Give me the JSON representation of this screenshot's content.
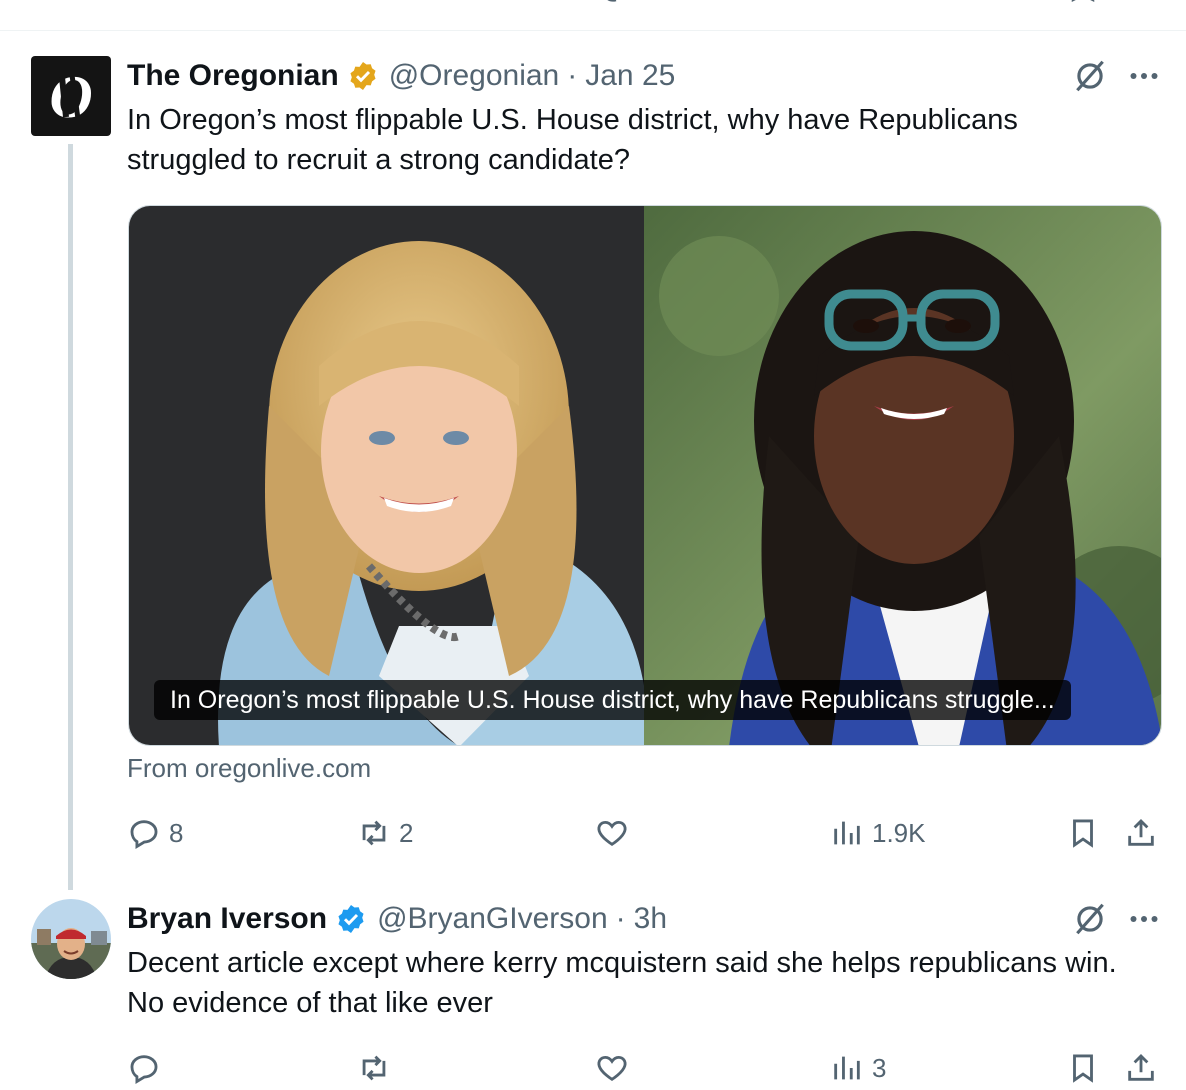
{
  "tweets": [
    {
      "display_name": "The Oregonian",
      "verified": "gold",
      "handle": "@Oregonian",
      "separator": "·",
      "time": "Jan 25",
      "text": "In Oregon’s most flippable U.S. House district, why have Republicans struggled to recruit a strong candidate?",
      "card": {
        "caption": "In Oregon’s most flippable U.S. House district, why have Republicans struggle...",
        "source": "From oregonlive.com"
      },
      "stats": {
        "replies": "8",
        "reposts": "2",
        "likes": "",
        "views": "1.9K"
      }
    },
    {
      "display_name": "Bryan Iverson",
      "verified": "blue",
      "handle": "@BryanGIverson",
      "separator": "·",
      "time": "3h",
      "text": "Decent article except where kerry mcquistern said she helps republicans win. No evidence of that like ever",
      "stats": {
        "replies": "",
        "reposts": "",
        "likes": "",
        "views": "3"
      }
    }
  ],
  "colors": {
    "gold_badge": "#e4a61b",
    "blue_badge": "#1d9bf0",
    "secondary_text": "#536471"
  },
  "icons": [
    "reply-icon",
    "repost-icon",
    "like-icon",
    "views-icon",
    "bookmark-icon",
    "share-icon",
    "grok-icon",
    "more-icon",
    "verified-badge-icon"
  ]
}
